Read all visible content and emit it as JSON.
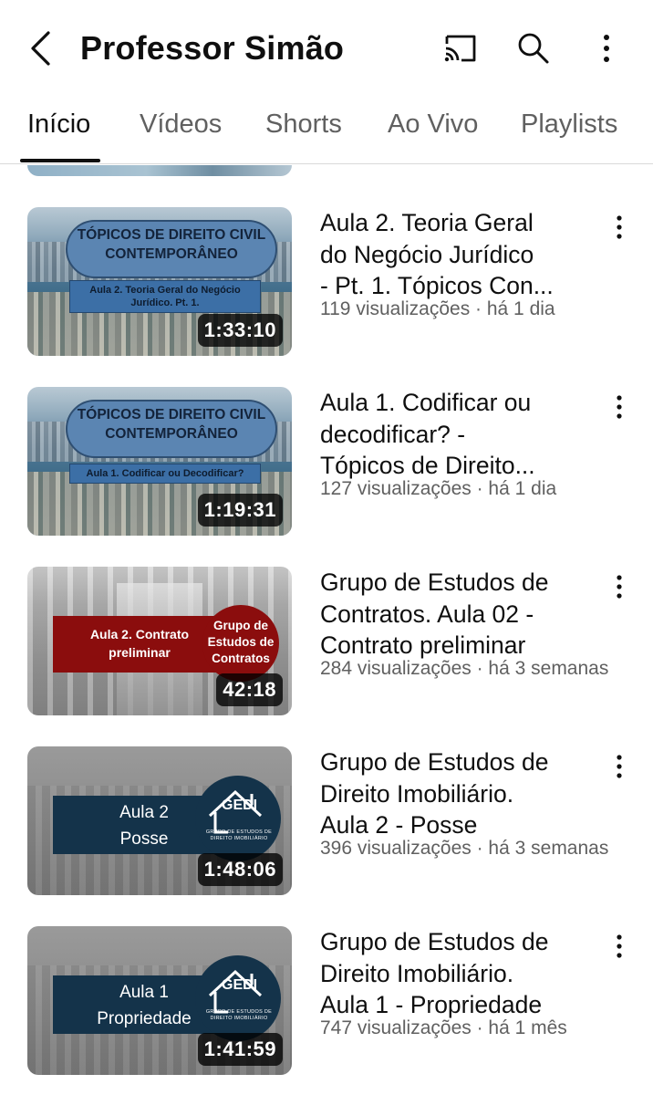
{
  "header": {
    "title": "Professor Simão",
    "back_icon": "chevron-left-icon",
    "cast_icon": "cast-icon",
    "search_icon": "search-icon",
    "more_icon": "more-vertical-icon"
  },
  "tabs": [
    {
      "label": "Início",
      "active": true
    },
    {
      "label": "Vídeos",
      "active": false
    },
    {
      "label": "Shorts",
      "active": false
    },
    {
      "label": "Ao Vivo",
      "active": false
    },
    {
      "label": "Playlists",
      "active": false
    }
  ],
  "videos": [
    {
      "title_lines": [
        "Aula 2. Teoria Geral",
        "do Negócio Jurídico",
        "- Pt. 1. Tópicos Con..."
      ],
      "meta": "119 visualizações · há 1 dia",
      "duration": "1:33:10",
      "thumb": {
        "heading": [
          "TÓPICOS DE DIREITO CIVIL",
          "CONTEMPORÂNEO"
        ],
        "subtitle": "Aula 2. Teoria Geral do Negócio Jurídico. Pt. 1."
      }
    },
    {
      "title_lines": [
        "Aula 1. Codificar ou",
        "decodificar?  -",
        "Tópicos de Direito..."
      ],
      "meta": "127 visualizações · há 1 dia",
      "duration": "1:19:31",
      "thumb": {
        "heading": [
          "TÓPICOS DE DIREITO CIVIL",
          "CONTEMPORÂNEO"
        ],
        "subtitle": "Aula 1. Codificar ou Decodificar?"
      }
    },
    {
      "title_lines": [
        "Grupo de Estudos de",
        "Contratos. Aula 02 -",
        "Contrato preliminar"
      ],
      "meta": "284 visualizações · há 3 semanas",
      "duration": "42:18",
      "thumb": {
        "banner": [
          "Aula 2. Contrato",
          "preliminar"
        ],
        "circle": [
          "Grupo de",
          "Estudos de",
          "Contratos"
        ]
      }
    },
    {
      "title_lines": [
        "Grupo de Estudos de",
        "Direito Imobiliário.",
        "Aula 2 - Posse"
      ],
      "meta": "396 visualizações · há 3 semanas",
      "duration": "1:48:06",
      "thumb": {
        "band": [
          "Aula 2",
          "Posse"
        ],
        "logo": "GEDI",
        "logo_sub": "GRUPO DE ESTUDOS DE DIREITO IMOBILIÁRIO"
      }
    },
    {
      "title_lines": [
        "Grupo de Estudos de",
        "Direito Imobiliário.",
        "Aula 1 - Propriedade"
      ],
      "meta": "747 visualizações · há 1 mês",
      "duration": "1:41:59",
      "thumb": {
        "band": [
          "Aula 1",
          "Propriedade"
        ],
        "logo": "GEDI",
        "logo_sub": "GRUPO DE ESTUDOS DE DIREITO IMOBILIÁRIO"
      }
    }
  ]
}
